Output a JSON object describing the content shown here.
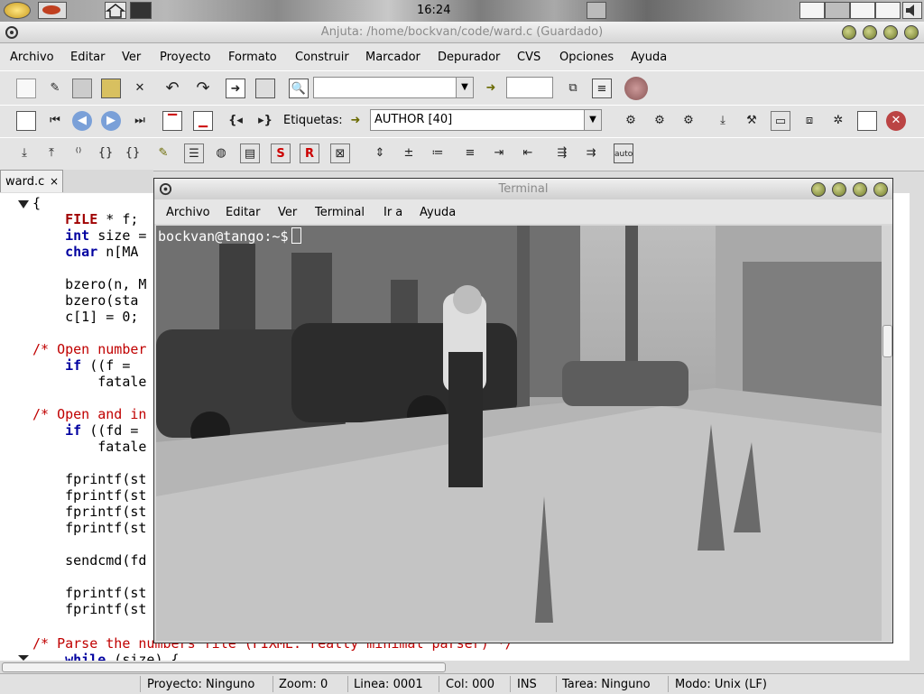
{
  "panel": {
    "clock": "16:24"
  },
  "window": {
    "title": "Anjuta: /home/bockvan/code/ward.c (Guardado)"
  },
  "menubar": [
    "Archivo",
    "Editar",
    "Ver",
    "Proyecto",
    "Formato",
    "Construir",
    "Marcador",
    "Depurador",
    "CVS",
    "Opciones",
    "Ayuda"
  ],
  "toolbar2": {
    "tags_label": "Etiquetas:",
    "tags_value": "AUTHOR [40]"
  },
  "editor": {
    "tab_label": "ward.c",
    "lines": [
      "{",
      "    FILE * f;",
      "    int size =",
      "    char n[MA",
      "",
      "    bzero(n, M",
      "    bzero(sta",
      "    c[1] = 0;",
      "",
      "/* Open number",
      "    if ((f =",
      "        fatale",
      "",
      "/* Open and in",
      "    if ((fd =",
      "        fatale",
      "",
      "    fprintf(st",
      "    fprintf(st",
      "    fprintf(st",
      "    fprintf(st",
      "",
      "    sendcmd(fd",
      "",
      "    fprintf(st",
      "    fprintf(st",
      "",
      "/* Parse the numbers file (FIXME: really minimal parser) */",
      "    while (size) {"
    ]
  },
  "terminal": {
    "title": "Terminal",
    "menu": [
      "Archivo",
      "Editar",
      "Ver",
      "Terminal",
      "Ir a",
      "Ayuda"
    ],
    "prompt": "bockvan@tango:~$"
  },
  "status": {
    "project": "Proyecto: Ninguno",
    "zoom": "Zoom: 0",
    "line": "Linea: 0001",
    "col": "Col: 000",
    "mode_ins": "INS",
    "task": "Tarea: Ninguno",
    "mode": "Modo: Unix (LF)"
  }
}
